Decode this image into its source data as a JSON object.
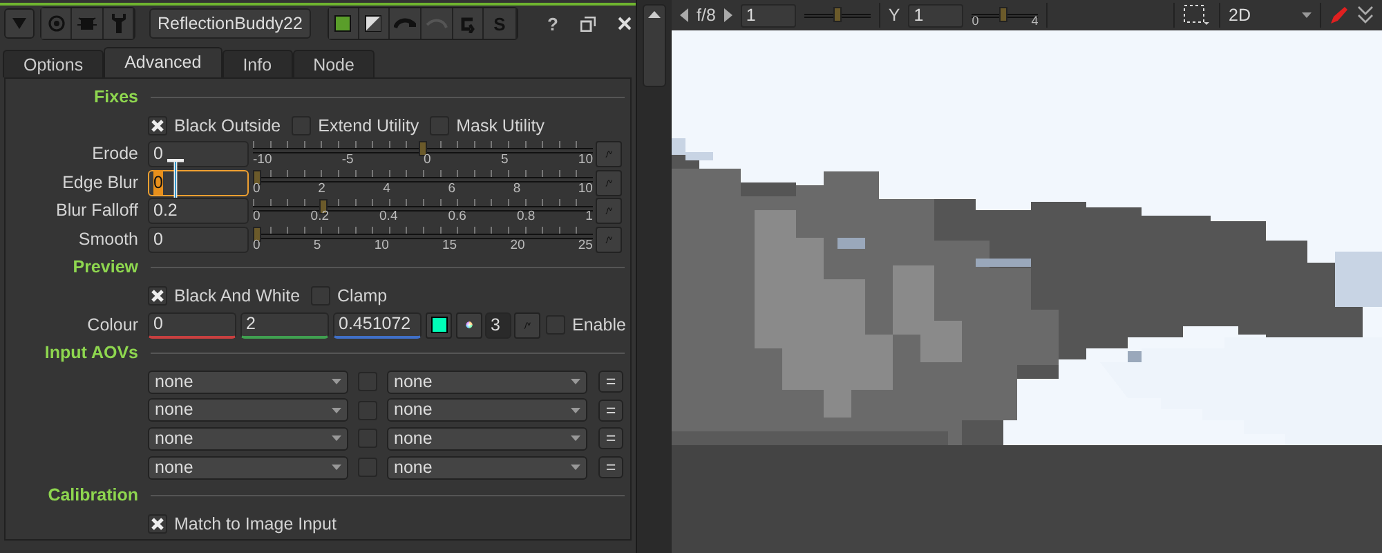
{
  "panel": {
    "header": {
      "node_name": "ReflectionBuddy22",
      "script_label": "S",
      "help_label": "?"
    },
    "tabs": [
      {
        "label": "Options",
        "selected": false
      },
      {
        "label": "Advanced",
        "selected": true
      },
      {
        "label": "Info",
        "selected": false
      },
      {
        "label": "Node",
        "selected": false
      }
    ],
    "sections": [
      {
        "title": "Fixes",
        "rows": [
          {
            "kind": "checkboxes",
            "items": [
              {
                "label": "Black Outside",
                "checked": true
              },
              {
                "label": "Extend Utility",
                "checked": false
              },
              {
                "label": "Mask Utility",
                "checked": false
              }
            ]
          },
          {
            "kind": "slider",
            "label": "Erode",
            "value": "0",
            "level": 0.5,
            "focused": false,
            "ticks": [
              "-10",
              "-5",
              "0",
              "5",
              "10"
            ]
          },
          {
            "kind": "slider",
            "label": "Edge Blur",
            "value": "0",
            "level": 0,
            "focused": true,
            "ticks": [
              "0",
              "2",
              "4",
              "6",
              "8",
              "10"
            ]
          },
          {
            "kind": "slider",
            "label": "Blur Falloff",
            "value": "0.2",
            "level": 0.2,
            "focused": false,
            "ticks": [
              "0",
              "0.2",
              "0.4",
              "0.6",
              "0.8",
              "1"
            ]
          },
          {
            "kind": "slider",
            "label": "Smooth",
            "value": "0",
            "level": 0,
            "focused": false,
            "ticks": [
              "0",
              "5",
              "10",
              "15",
              "20",
              "25"
            ]
          }
        ]
      },
      {
        "title": "Preview",
        "rows": [
          {
            "kind": "checkboxes",
            "items": [
              {
                "label": "Black And White",
                "checked": true
              },
              {
                "label": "Clamp",
                "checked": false
              }
            ]
          },
          {
            "kind": "colour",
            "label": "Colour",
            "values": [
              "0",
              "2",
              "0.451072"
            ],
            "channels": "3",
            "enable": {
              "label": "Enable",
              "checked": false
            }
          }
        ]
      },
      {
        "title": "Input AOVs",
        "rows": [
          {
            "kind": "aov",
            "left": "none",
            "right": "none",
            "linked": false,
            "swap": "="
          },
          {
            "kind": "aov",
            "left": "none",
            "right": "none",
            "linked": false,
            "swap": "="
          },
          {
            "kind": "aov",
            "left": "none",
            "right": "none",
            "linked": false,
            "swap": "="
          },
          {
            "kind": "aov",
            "left": "none",
            "right": "none",
            "linked": false,
            "swap": "="
          }
        ]
      },
      {
        "title": "Calibration",
        "rows": [
          {
            "kind": "checkboxes",
            "items": [
              {
                "label": "Match to Image Input",
                "checked": true
              }
            ]
          }
        ]
      }
    ]
  },
  "viewer": {
    "toolbar": {
      "frame_stop": "f/8",
      "gain": "1",
      "gain_slider": {
        "level": 0.5
      },
      "gamma_label": "Y",
      "gamma": "1",
      "gamma_slider": {
        "level": 0.48,
        "ticks": [
          "0",
          "4"
        ]
      },
      "view_mode": "2D"
    }
  }
}
